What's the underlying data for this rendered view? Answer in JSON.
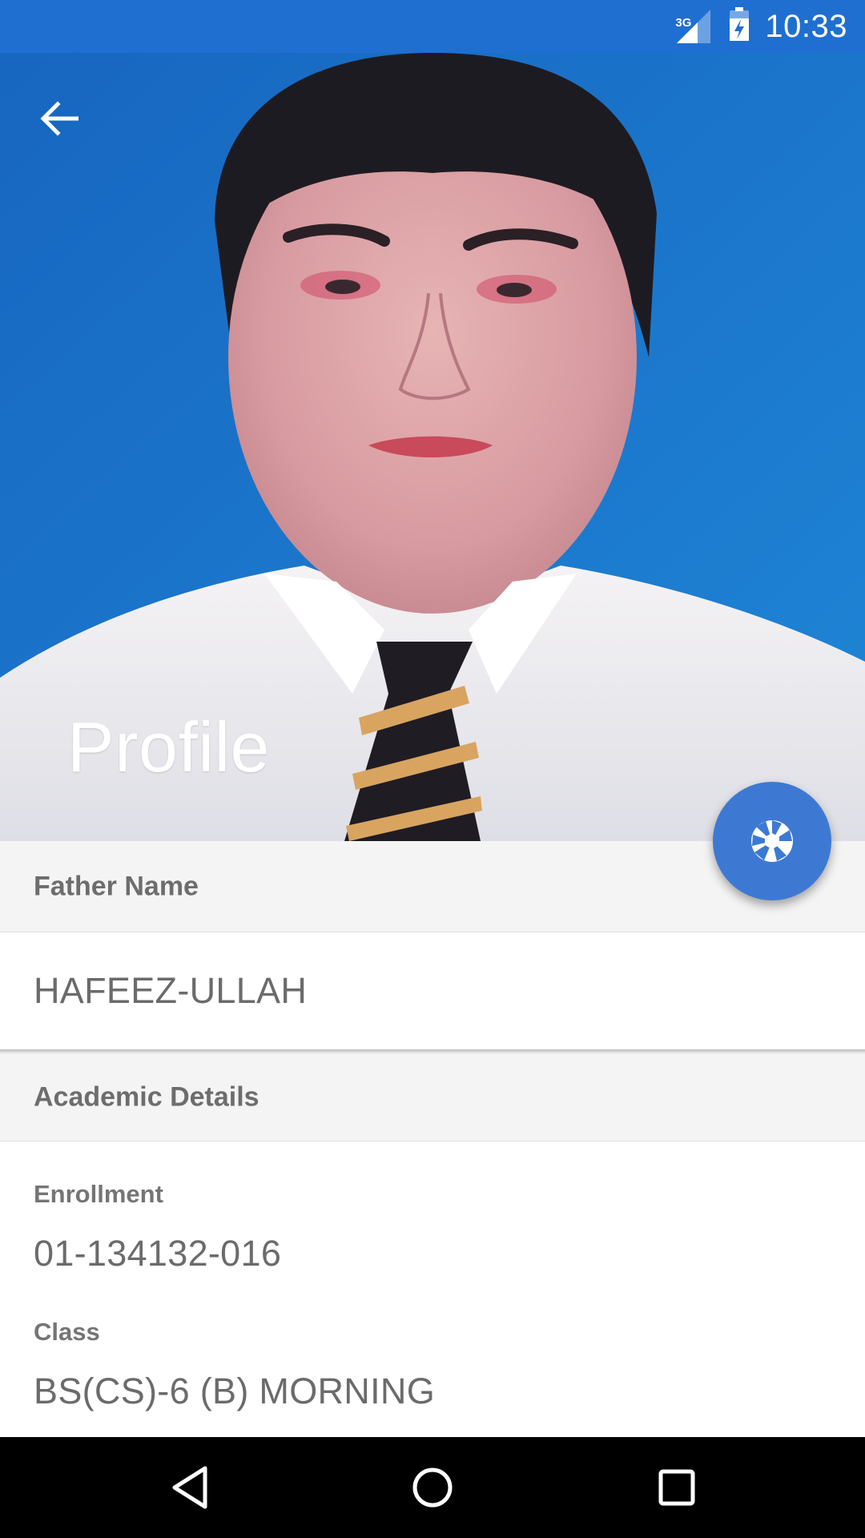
{
  "status_bar": {
    "network_label": "3G",
    "time": "10:33",
    "background_color": "#1f6fd1"
  },
  "header": {
    "title": "Profile",
    "back_icon": "arrow-back-icon",
    "photo_background_color": "#1a73c8"
  },
  "fab": {
    "icon": "camera-shutter-icon",
    "color": "#3d79d3"
  },
  "sections": {
    "father": {
      "heading": "Father Name",
      "value": "HAFEEZ-ULLAH"
    },
    "academic": {
      "heading": "Academic Details",
      "enrollment_label": "Enrollment",
      "enrollment_value": "01-134132-016",
      "class_label": "Class",
      "class_value": "BS(CS)-6 (B) MORNING"
    }
  },
  "nav_bar": {
    "back_icon": "nav-back-triangle-icon",
    "home_icon": "nav-home-circle-icon",
    "recents_icon": "nav-recents-square-icon"
  }
}
